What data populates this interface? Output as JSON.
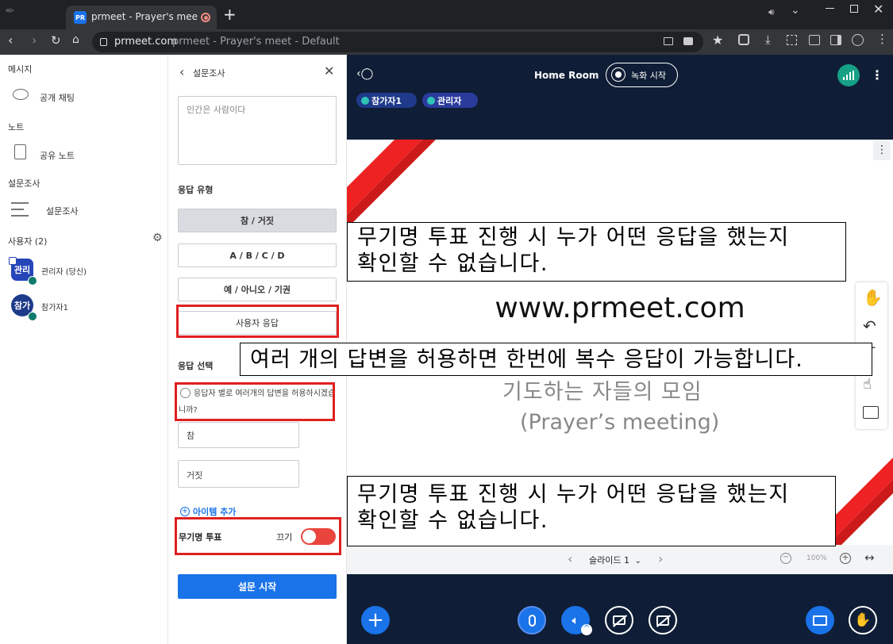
{
  "browser": {
    "tab_title": "prmeet - Prayer's meet - De",
    "favicon_text": "PR",
    "url_domain": "prmeet.com",
    "url_rest": "prmeet - Prayer's meet - Default"
  },
  "sidebar": {
    "messages_header": "메시지",
    "public_chat": "공개 채팅",
    "notes_header": "노트",
    "shared_notes": "공유 노트",
    "polls_header": "설문조사",
    "polls_item": "설문조사",
    "users_header": "사용자 (2)",
    "users": [
      {
        "avatar": "관리",
        "name": "관리자 (당신)",
        "color": "#2545b8"
      },
      {
        "avatar": "참가",
        "name": "참가자1",
        "color": "#1e3a8a"
      }
    ]
  },
  "poll": {
    "back_label": "설문조사",
    "question_placeholder": "인간은 사람이다",
    "response_type_label": "응답 유형",
    "types": [
      "참 / 거짓",
      "A / B / C / D",
      "예 / 아니오 / 기권",
      "사용자 응답"
    ],
    "response_select_label": "응답 선택",
    "multi_answer_text": "응답자 별로 여러개의 답변을 허용하시겠습니까?",
    "options": [
      "참",
      "거짓"
    ],
    "add_item": "아이템 추가",
    "anonymous_label": "무기명 투표",
    "anonymous_state": "끄기",
    "start_button": "설문 시작"
  },
  "topbar": {
    "room_name": "Home Room",
    "record_label": "녹화 시작",
    "badges": [
      "참가자1",
      "관리자"
    ]
  },
  "slide": {
    "url_text": "www.prmeet.com",
    "subtitle_kr": "기도하는 자들의 모임",
    "subtitle_en": "(Prayer’s meeting)",
    "nav_label": "슬라이드 1",
    "zoom": "100%"
  },
  "annotations": {
    "note1_line1": "무기명 투표 진행 시 누가 어떤 응답을 했는지",
    "note1_line2": "확인할 수 없습니다.",
    "note2": "여러 개의 답변을 허용하면 한번에 복수 응답이 가능합니다.",
    "note3_line1": "무기명 투표 진행 시 누가 어떤 응답을 했는지",
    "note3_line2": "확인할 수 없습니다."
  },
  "colors": {
    "brand_blue": "#1a73e8",
    "dark_navy": "#0f1e36",
    "red_accent": "#e02020",
    "toggle_red": "#e8453c",
    "signal_green": "#16a085"
  }
}
